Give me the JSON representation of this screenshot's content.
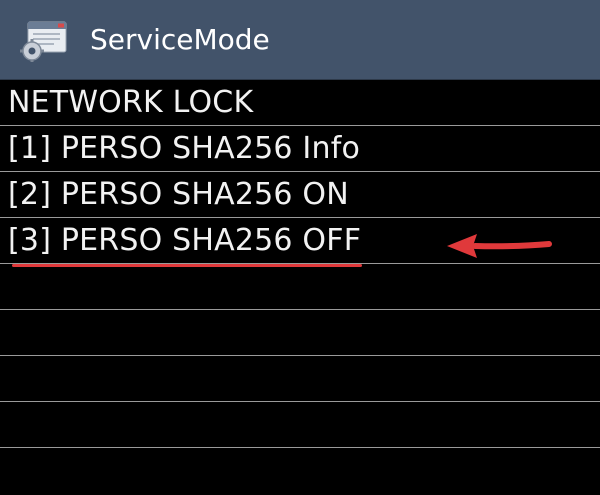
{
  "app": {
    "title": "ServiceMode",
    "icon": "settings-window-icon"
  },
  "menu": {
    "items": [
      {
        "label": "NETWORK LOCK",
        "selected": false
      },
      {
        "label": "[1] PERSO SHA256 Info",
        "selected": false
      },
      {
        "label": "[2] PERSO SHA256 ON",
        "selected": false
      },
      {
        "label": "[3] PERSO SHA256 OFF",
        "selected": true
      },
      {
        "label": "",
        "selected": false
      },
      {
        "label": "",
        "selected": false
      },
      {
        "label": "",
        "selected": false
      },
      {
        "label": "",
        "selected": false
      },
      {
        "label": "",
        "selected": false
      }
    ]
  },
  "annotation": {
    "color": "#e0393b",
    "target": "[3] PERSO SHA256 OFF"
  },
  "colors": {
    "titlebar": "#42536a",
    "background": "#000000",
    "divider": "#9a9a9a",
    "text": "#f2f2f2"
  }
}
